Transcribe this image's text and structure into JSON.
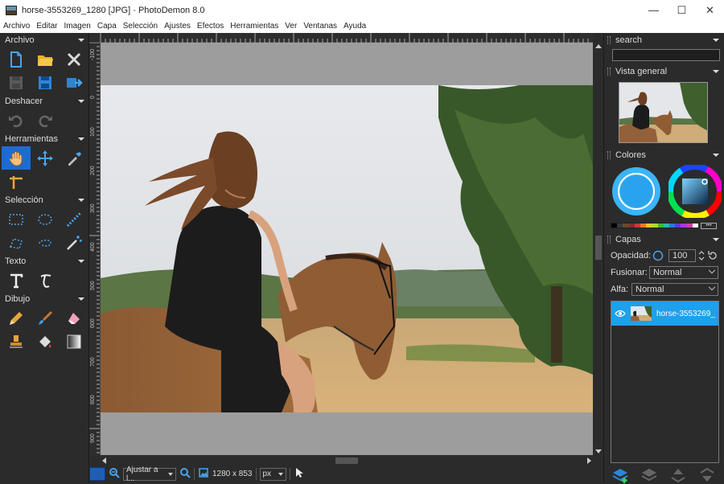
{
  "window": {
    "file_name": "horse-3553269_1280",
    "file_type": "[JPG]",
    "separator": "-",
    "app_name": "PhotoDemon 8.0",
    "minimize_label": "—",
    "maximize_label": "☐",
    "close_label": "✕"
  },
  "menubar": {
    "items": [
      "Archivo",
      "Editar",
      "Imagen",
      "Capa",
      "Selección",
      "Ajustes",
      "Efectos",
      "Herramientas",
      "Ver",
      "Ventanas",
      "Ayuda"
    ]
  },
  "toolbox": {
    "sections": {
      "archivo": "Archivo",
      "deshacer": "Deshacer",
      "herramientas": "Herramientas",
      "seleccion": "Selección",
      "texto": "Texto",
      "dibujo": "Dibujo"
    },
    "active_tool": "hand-tool",
    "accent_color": "#1f6bd1"
  },
  "ruler": {
    "left_labels": [
      "-100",
      "0",
      "100",
      "200",
      "300",
      "400",
      "500",
      "600",
      "700",
      "800",
      "900"
    ]
  },
  "statusbar": {
    "zoom_value": "Ajustar a l...",
    "image_size": "1280 x 853",
    "unit": "px",
    "primary_color": "#1e5fb5"
  },
  "rightpanel": {
    "search_title": "search",
    "search_placeholder": "",
    "overview_title": "Vista general",
    "colors_title": "Colores",
    "color_wheel_selected": "#3cb4f5",
    "palette_more": "•••",
    "layers_title": "Capas",
    "opacity_label": "Opacidad:",
    "opacity_value": "100",
    "blend_label": "Fusionar:",
    "blend_value": "Normal",
    "alpha_label": "Alfa:",
    "alpha_value": "Normal",
    "layers": [
      {
        "name": "horse-3553269_",
        "visible": true,
        "selected_color": "#1ea0ec"
      }
    ]
  }
}
